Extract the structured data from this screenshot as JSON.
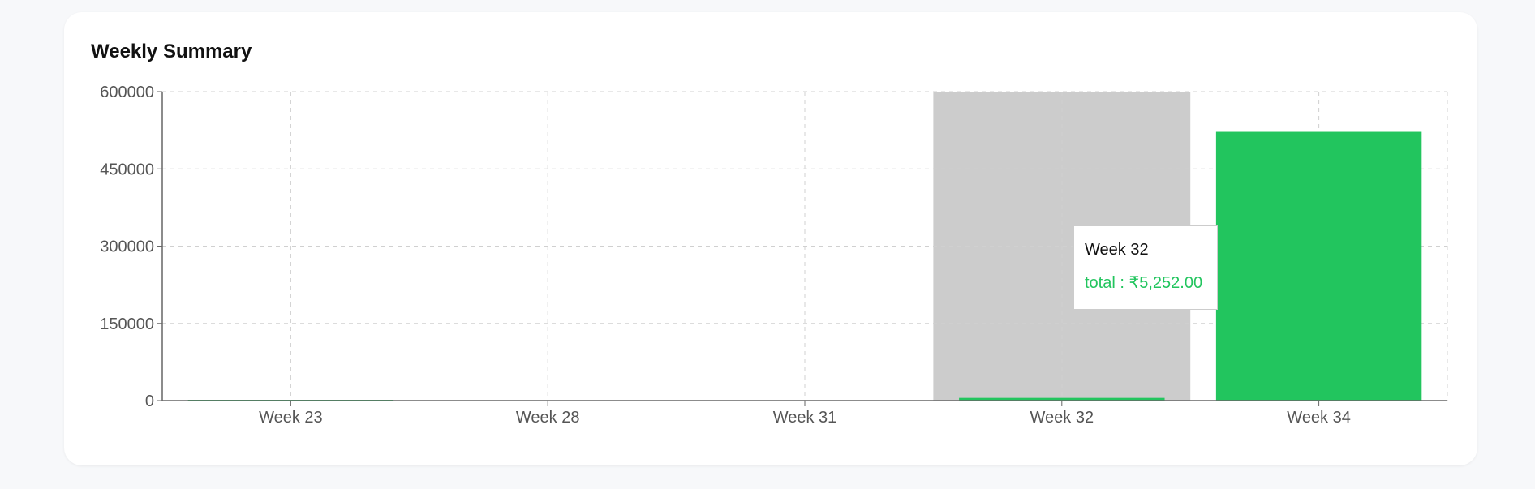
{
  "card": {
    "title": "Weekly Summary"
  },
  "tooltip": {
    "label": "Week 32",
    "series_key": "total",
    "separator": " : ",
    "value_text": "₹5,252.00"
  },
  "colors": {
    "bar": "#22c55e",
    "active_cursor": "#cccccc",
    "grid": "#d0d0d0",
    "axis": "#666666",
    "tick_text": "#555555"
  },
  "chart_data": {
    "type": "bar",
    "title": "Weekly Summary",
    "xlabel": "",
    "ylabel": "",
    "categories": [
      "Week 23",
      "Week 28",
      "Week 31",
      "Week 32",
      "Week 34"
    ],
    "series": [
      {
        "values": [
          350,
          0,
          0,
          5252,
          522000
        ]
      }
    ],
    "yticks": [
      0,
      150000,
      300000,
      450000,
      600000
    ],
    "ylim": [
      0,
      600000
    ],
    "grid": true,
    "active_category": "Week 32"
  }
}
